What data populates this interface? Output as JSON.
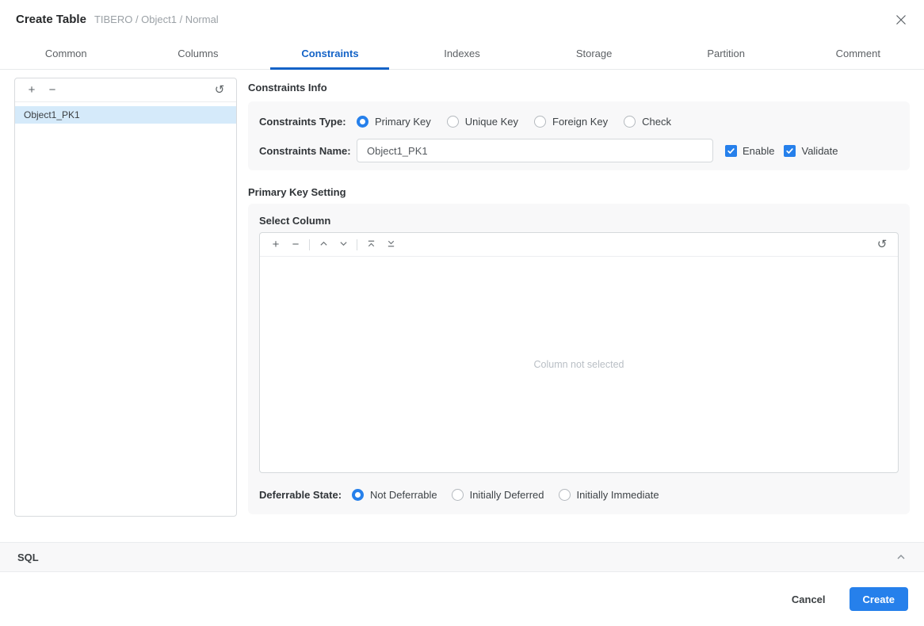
{
  "window": {
    "title": "Create Table",
    "subtitle": "TIBERO / Object1 / Normal"
  },
  "tabs": [
    {
      "label": "Common",
      "active": false
    },
    {
      "label": "Columns",
      "active": false
    },
    {
      "label": "Constraints",
      "active": true
    },
    {
      "label": "Indexes",
      "active": false
    },
    {
      "label": "Storage",
      "active": false
    },
    {
      "label": "Partition",
      "active": false
    },
    {
      "label": "Comment",
      "active": false
    }
  ],
  "constraint_list": {
    "toolbar": {
      "add": "+",
      "remove": "−",
      "refresh": "↺"
    },
    "items": [
      {
        "name": "Object1_PK1",
        "selected": true
      }
    ]
  },
  "constraints_info": {
    "title": "Constraints Info",
    "type_label": "Constraints Type:",
    "type_options": [
      {
        "label": "Primary Key",
        "selected": true
      },
      {
        "label": "Unique Key",
        "selected": false
      },
      {
        "label": "Foreign Key",
        "selected": false
      },
      {
        "label": "Check",
        "selected": false
      }
    ],
    "name_label": "Constraints Name:",
    "name_value": "Object1_PK1",
    "enable": {
      "label": "Enable",
      "checked": true
    },
    "validate": {
      "label": "Validate",
      "checked": true
    }
  },
  "primary_key_setting": {
    "title": "Primary Key Setting",
    "select_column": {
      "label": "Select Column",
      "toolbar": {
        "add": "+",
        "remove": "−",
        "refresh": "↺"
      },
      "empty_text": "Column not selected"
    },
    "deferrable_label": "Deferrable State:",
    "deferrable_options": [
      {
        "label": "Not Deferrable",
        "selected": true
      },
      {
        "label": "Initially Deferred",
        "selected": false
      },
      {
        "label": "Initially Immediate",
        "selected": false
      }
    ]
  },
  "sql_panel": {
    "label": "SQL"
  },
  "footer": {
    "cancel_label": "Cancel",
    "create_label": "Create"
  },
  "colors": {
    "accent": "#2680eb",
    "tab_active": "#1463c7",
    "selection_bg": "#d5eafa"
  }
}
